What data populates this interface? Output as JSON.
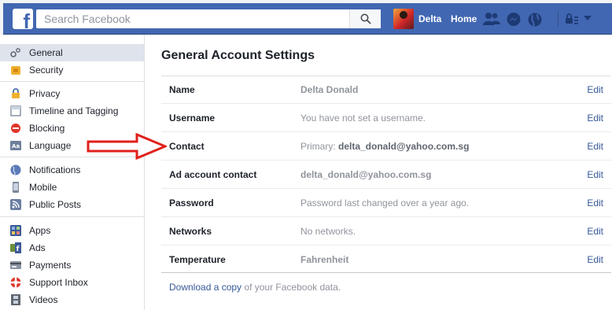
{
  "header": {
    "logo_letter": "f",
    "search_placeholder": "Search Facebook",
    "profile_name": "Delta",
    "home_label": "Home",
    "brand_color": "#4267b2"
  },
  "sidebar": {
    "items": [
      {
        "label": "General",
        "icon": "gears-icon",
        "active": true
      },
      {
        "label": "Security",
        "icon": "shield-icon"
      },
      {
        "label": "Privacy",
        "icon": "lock-icon"
      },
      {
        "label": "Timeline and Tagging",
        "icon": "timeline-icon"
      },
      {
        "label": "Blocking",
        "icon": "block-icon"
      },
      {
        "label": "Language",
        "icon": "language-icon"
      },
      {
        "label": "Notifications",
        "icon": "globe-icon"
      },
      {
        "label": "Mobile",
        "icon": "mobile-icon"
      },
      {
        "label": "Public Posts",
        "icon": "rss-icon"
      },
      {
        "label": "Apps",
        "icon": "apps-icon"
      },
      {
        "label": "Ads",
        "icon": "ads-icon"
      },
      {
        "label": "Payments",
        "icon": "card-icon"
      },
      {
        "label": "Support Inbox",
        "icon": "lifebuoy-icon"
      },
      {
        "label": "Videos",
        "icon": "film-icon"
      }
    ]
  },
  "main": {
    "title": "General Account Settings",
    "rows": [
      {
        "label": "Name",
        "value": "Delta Donald",
        "edit": "Edit"
      },
      {
        "label": "Username",
        "value": "You have not set a username.",
        "edit": "Edit"
      },
      {
        "label": "Contact",
        "value_prefix": "Primary: ",
        "value": "delta_donald@yahoo.com.sg",
        "edit": "Edit"
      },
      {
        "label": "Ad account contact",
        "value": "delta_donald@yahoo.com.sg",
        "edit": "Edit"
      },
      {
        "label": "Password",
        "value": "Password last changed over a year ago.",
        "edit": "Edit"
      },
      {
        "label": "Networks",
        "value": "No networks.",
        "edit": "Edit"
      },
      {
        "label": "Temperature",
        "value": "Fahrenheit",
        "edit": "Edit"
      }
    ],
    "download_link": "Download a copy",
    "download_suffix": " of your Facebook data."
  },
  "annotation": {
    "arrow_color": "#e0201b"
  }
}
